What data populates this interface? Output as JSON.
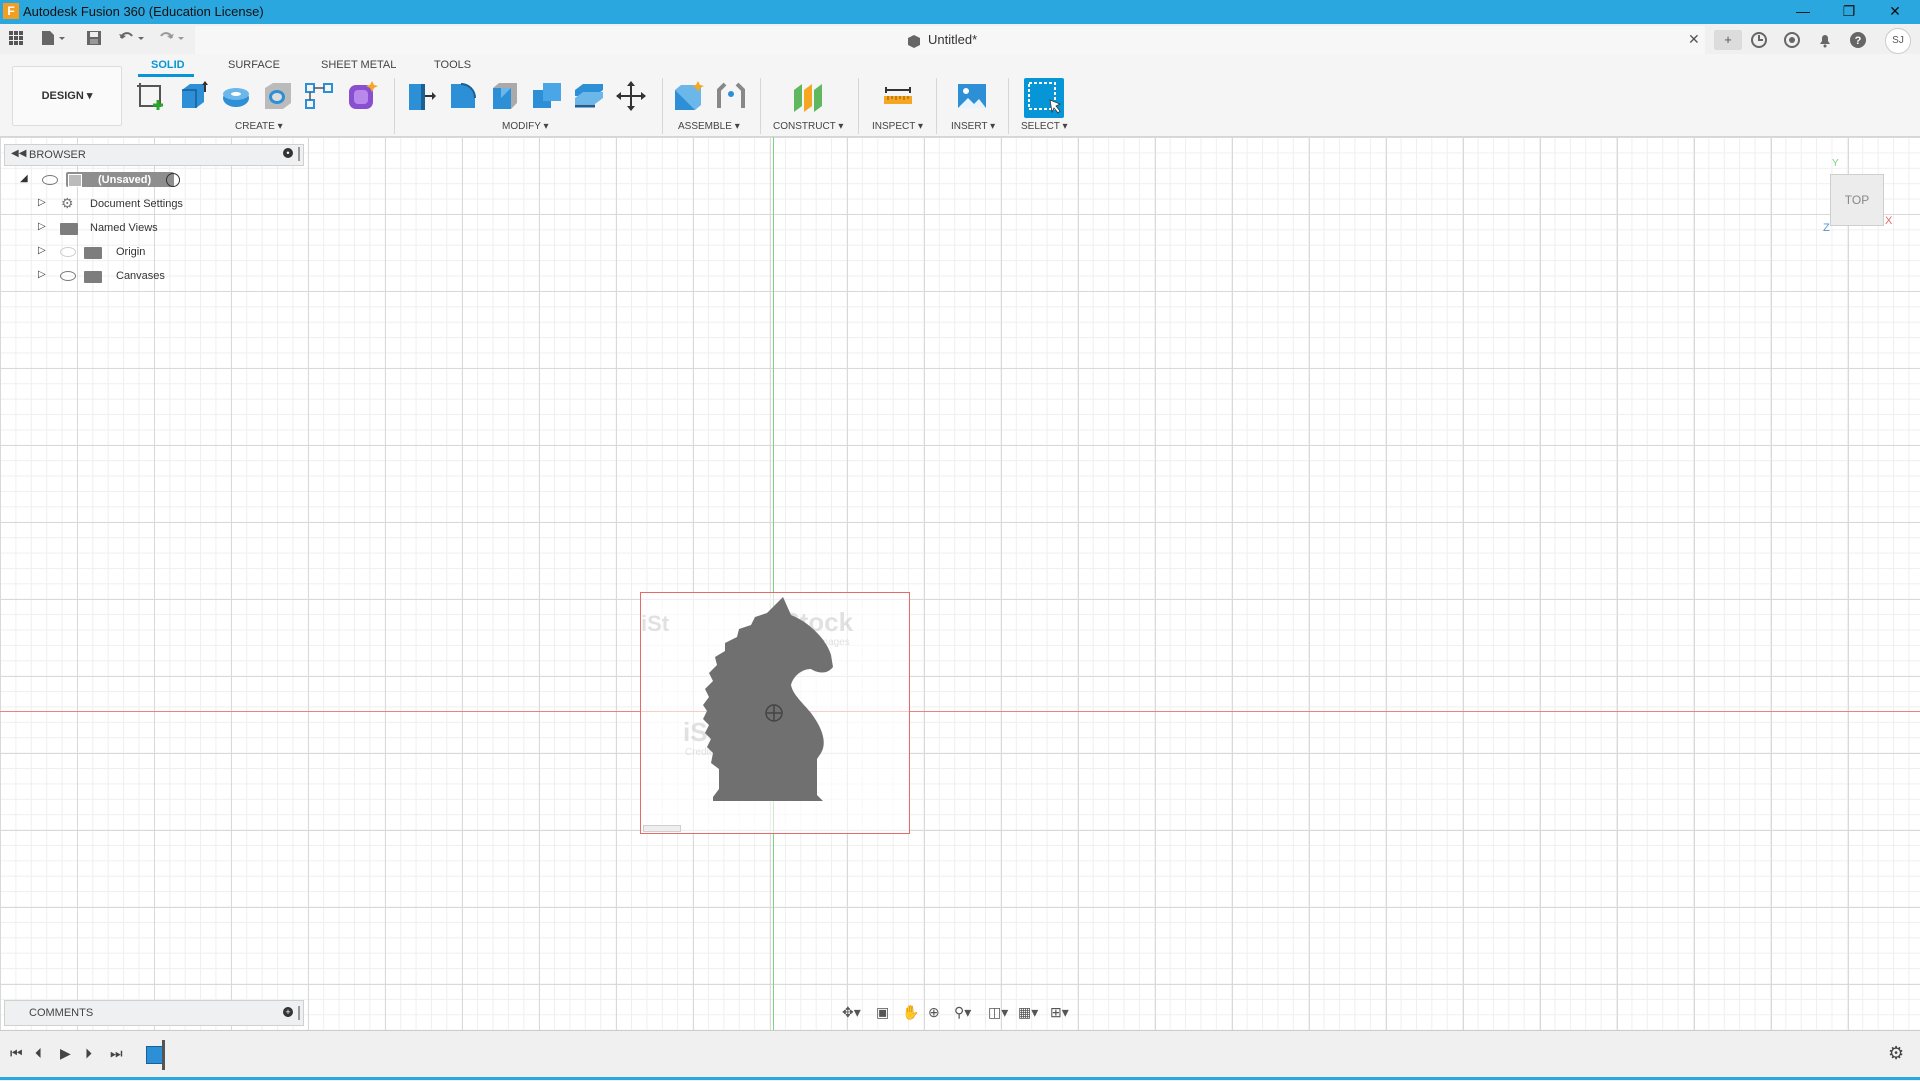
{
  "window": {
    "title": "Autodesk Fusion 360 (Education License)",
    "app_icon": "F",
    "minimize_icon": "minimize-icon",
    "restore_icon": "restore-icon",
    "close_icon": "close-icon"
  },
  "document": {
    "title": "Untitled*"
  },
  "quick_access": {
    "icons": [
      "grid-icon",
      "file-icon",
      "save-icon",
      "undo-icon",
      "redo-icon"
    ]
  },
  "right_icons": [
    "new-tab-icon",
    "extensions-icon",
    "job-status-icon",
    "notifications-icon",
    "help-icon"
  ],
  "user": {
    "initials": "SJ"
  },
  "workspace": {
    "label": "DESIGN"
  },
  "tabs": [
    "SOLID",
    "SURFACE",
    "SHEET METAL",
    "TOOLS"
  ],
  "groups": {
    "create": "CREATE",
    "modify": "MODIFY",
    "assemble": "ASSEMBLE",
    "construct": "CONSTRUCT",
    "inspect": "INSPECT",
    "insert": "INSERT",
    "select": "SELECT"
  },
  "browser": {
    "header": "BROWSER",
    "root": "(Unsaved)",
    "items": [
      {
        "label": "Document Settings",
        "icon": "gear-icon"
      },
      {
        "label": "Named Views",
        "icon": "folder-icon"
      },
      {
        "label": "Origin",
        "icon": "folder-icon"
      },
      {
        "label": "Canvases",
        "icon": "folder-icon"
      }
    ]
  },
  "comments": {
    "header": "COMMENTS"
  },
  "viewcube": {
    "face": "TOP",
    "axis_x": "X",
    "axis_y": "Y",
    "axis_z": "Z"
  },
  "canvas": {
    "image": "chess-knight-silhouette",
    "watermarks": [
      "iStock",
      "by Getty Images",
      "iStock",
      "Credit: Getty Images",
      "iSt"
    ]
  },
  "timeline": {
    "buttons": [
      "go-to-start-icon",
      "step-back-icon",
      "play-icon",
      "step-forward-icon",
      "go-to-end-icon"
    ]
  },
  "colors": {
    "titlebar": "#2ba7e0",
    "accent": "#0696d7",
    "x_axis": "#f08080",
    "y_axis": "#7fd37f"
  }
}
